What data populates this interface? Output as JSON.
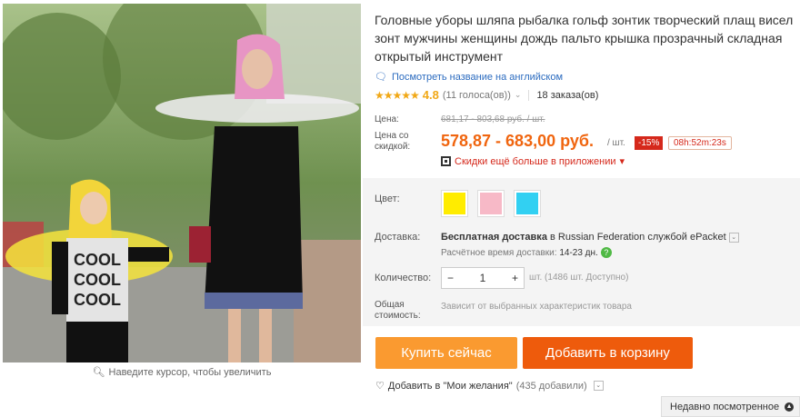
{
  "product": {
    "title": "Головные уборы шляпа рыбалка гольф зонтик творческий плащ висел зонт мужчины женщины дождь пальто крышка прозрачный складная открытый инструмент",
    "translate_link": "Посмотреть название на английском",
    "rating_stars": "★★★★★",
    "rating_value": "4.8",
    "votes": "(11 голоса(ов))",
    "orders": "18 заказа(ов)"
  },
  "gallery": {
    "zoom_hint": "Наведите курсор, чтобы увеличить",
    "kid_shirt_text": [
      "COOL",
      "COOL",
      "COOL"
    ]
  },
  "price": {
    "label": "Цена:",
    "old_price": "681,17 - 803,68 руб. / шт.",
    "discount_label_line1": "Цена со",
    "discount_label_line2": "скидкой:",
    "new_price": "578,87 - 683,00 руб.",
    "per_unit": "/ шт.",
    "discount_badge": "-15%",
    "timer": "08h:52m:23s",
    "app_promo": "Скидки ещё больше в приложении",
    "app_promo_arrow": "▾"
  },
  "options": {
    "color_label": "Цвет:",
    "colors": [
      "#ffec00",
      "#f7b9c7",
      "#32d0f2"
    ],
    "shipping_label": "Доставка:",
    "shipping_bold": "Бесплатная доставка",
    "shipping_rest": " в Russian Federation службой ePacket",
    "delivery_time_label": "Расчётное время доставки:",
    "delivery_time_value": "14-23 дн.",
    "quantity_label": "Количество:",
    "quantity_value": "1",
    "quantity_minus": "−",
    "quantity_plus": "+",
    "quantity_note": "шт. (1486 шт. Доступно)",
    "total_label_line1": "Общая",
    "total_label_line2": "стоимость:",
    "total_note": "Зависит от выбранных характеристик товара"
  },
  "actions": {
    "buy_now": "Купить сейчас",
    "add_to_cart": "Добавить в корзину",
    "wishlist": "Добавить в \"Мои желания\"",
    "wishlist_count": "(435 добавили)"
  },
  "recent": {
    "label": "Недавно посмотренное"
  },
  "accent_colors": {
    "price": "#f0650f",
    "buy": "#fa9a30",
    "cart": "#ee5b0c"
  }
}
